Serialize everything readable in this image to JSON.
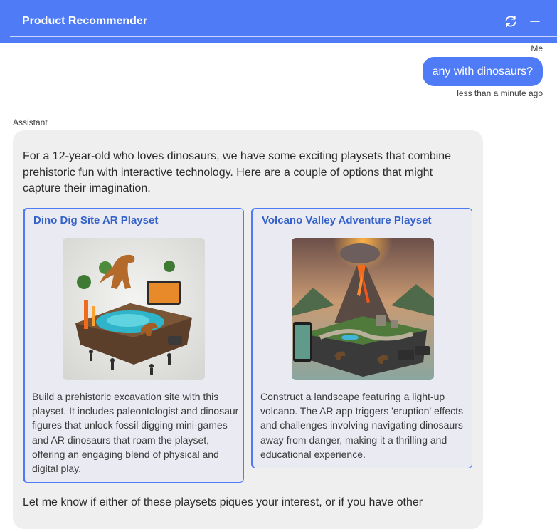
{
  "app": {
    "title": "Product Recommender",
    "accent_color": "#4f7bf7",
    "header_icons": [
      "refresh-icon",
      "minimize-icon"
    ]
  },
  "chat": {
    "user": {
      "sender": "Me",
      "message": "any with dinosaurs?",
      "timestamp": "less than a minute ago"
    },
    "assistant": {
      "sender": "Assistant",
      "intro": "For a 12-year-old who loves dinosaurs, we have some exciting playsets that combine prehistoric fun with interactive technology. Here are a couple of options that might capture their imagination.",
      "products": [
        {
          "title": "Dino Dig Site AR Playset",
          "image": "dino-dig-site-playset-image",
          "description": "Build a prehistoric excavation site with this playset. It includes paleontologist and dinosaur figures that unlock fossil digging mini-games and AR dinosaurs that roam the playset, offering an engaging blend of physical and digital play."
        },
        {
          "title": "Volcano Valley Adventure Playset",
          "image": "volcano-valley-playset-image",
          "description": "Construct a landscape featuring a light-up volcano. The AR app triggers 'eruption' effects and challenges involving navigating dinosaurs away from danger, making it a thrilling and educational experience."
        }
      ],
      "outro": "Let me know if either of these playsets piques your interest, or if you have other"
    }
  }
}
